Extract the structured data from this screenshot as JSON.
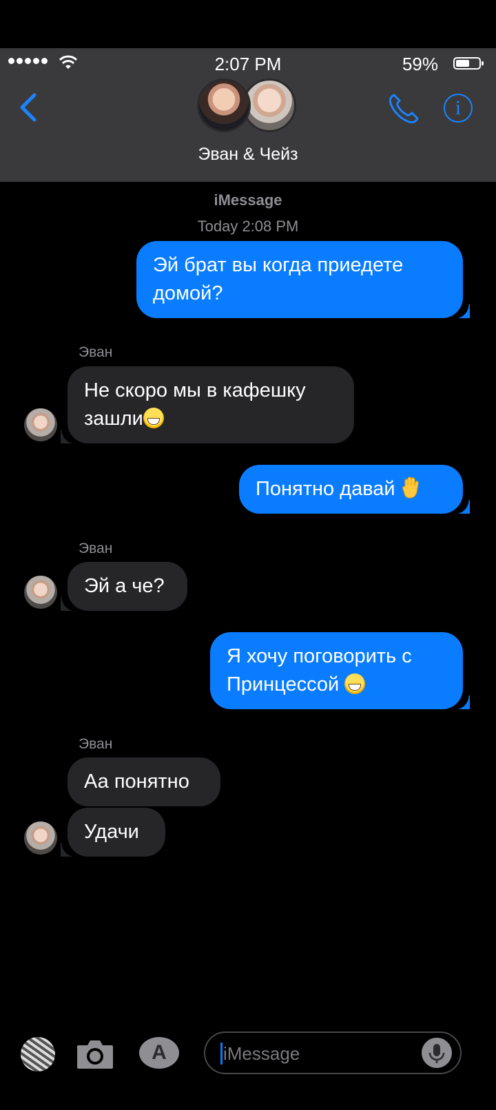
{
  "status_bar": {
    "time": "2:07 PM",
    "battery_percent": "59%",
    "battery_level": 0.59
  },
  "header": {
    "title": "Эван & Чейз",
    "back_icon": "chevron-left-icon",
    "call_icon": "phone-icon",
    "info_icon": "info-icon",
    "info_glyph": "i"
  },
  "transcript": {
    "service": "iMessage",
    "timestamp": "Today 2:08 PM",
    "messages": [
      {
        "dir": "out",
        "text": "Эй брат вы когда приедете домой?"
      },
      {
        "dir": "in",
        "sender": "Эван",
        "text": "Не скоро мы в кафешку зашли",
        "emoji": "grinning-face"
      },
      {
        "dir": "out",
        "text": "Понятно давай",
        "emoji": "raised-hand"
      },
      {
        "dir": "in",
        "sender": "Эван",
        "text": "Эй а че?"
      },
      {
        "dir": "out",
        "text": "Я хочу поговорить с Принцессой",
        "emoji": "grinning-sweat-face"
      },
      {
        "dir": "in",
        "sender": "Эван",
        "text": "Аа понятно"
      },
      {
        "dir": "in",
        "text": "Удачи"
      }
    ]
  },
  "composer": {
    "placeholder": "iMessage",
    "apps_icon": "photos-apps-icon",
    "camera_icon": "camera-icon",
    "appstore_icon": "app-store-icon",
    "mic_icon": "microphone-icon"
  },
  "colors": {
    "outgoing": "#0a7cff",
    "incoming": "#262629",
    "accent": "#1a84ff",
    "bar": "#3a3a3c"
  }
}
